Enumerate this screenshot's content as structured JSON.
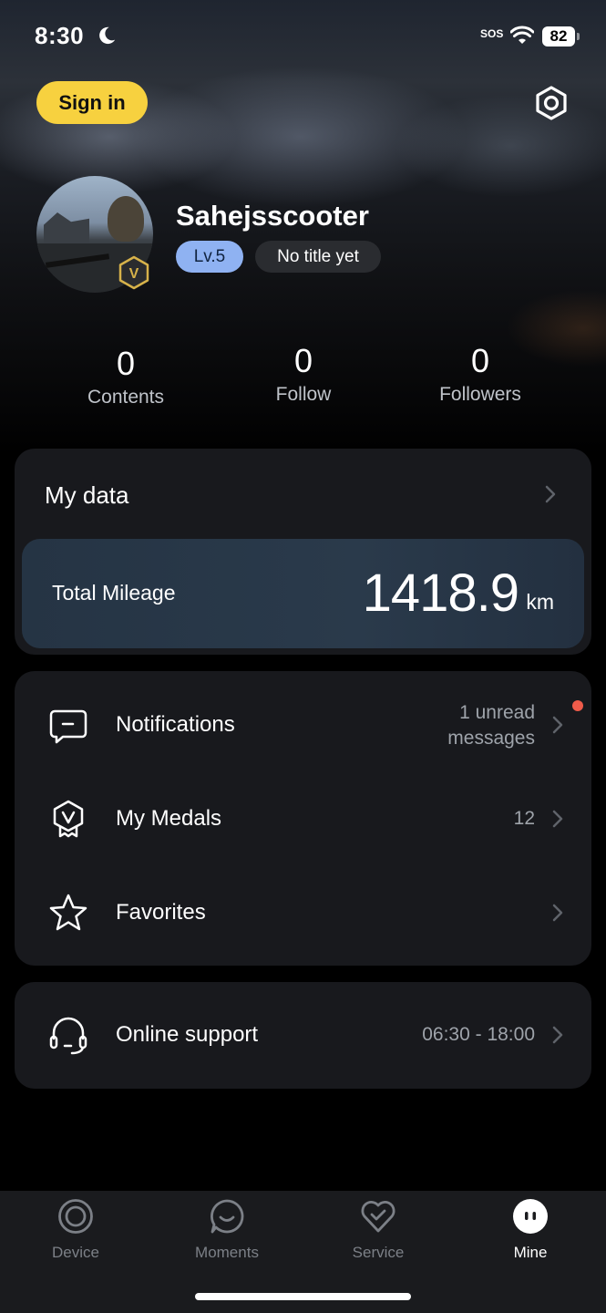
{
  "status_bar": {
    "time": "8:30",
    "sos": "SOS",
    "battery": "82"
  },
  "header": {
    "sign_in_label": "Sign in"
  },
  "profile": {
    "username": "Sahejsscooter",
    "level": "Lv.5",
    "title": "No title yet",
    "badge_letter": "V"
  },
  "stats": [
    {
      "value": "0",
      "label": "Contents"
    },
    {
      "value": "0",
      "label": "Follow"
    },
    {
      "value": "0",
      "label": "Followers"
    }
  ],
  "my_data": {
    "title": "My data",
    "mileage_label": "Total Mileage",
    "mileage_value": "1418.9",
    "mileage_unit": "km"
  },
  "menu": [
    {
      "label": "Notifications",
      "value_line1": "1 unread",
      "value_line2": "messages",
      "icon": "message-icon"
    },
    {
      "label": "My Medals",
      "value": "12",
      "icon": "medal-icon"
    },
    {
      "label": "Favorites",
      "value": "",
      "icon": "star-icon"
    }
  ],
  "support": {
    "label": "Online support",
    "hours": "06:30 - 18:00",
    "icon": "headset-icon"
  },
  "tabs": [
    {
      "label": "Device",
      "icon": "device-icon"
    },
    {
      "label": "Moments",
      "icon": "moments-icon"
    },
    {
      "label": "Service",
      "icon": "service-icon"
    },
    {
      "label": "Mine",
      "icon": "mine-icon",
      "active": true
    }
  ],
  "colors": {
    "accent": "#f7d13f",
    "level_pill": "#8fb2f2",
    "unread_dot": "#ef5b4a",
    "card": "#18191d",
    "mileage_card": "#2a3a4b"
  }
}
